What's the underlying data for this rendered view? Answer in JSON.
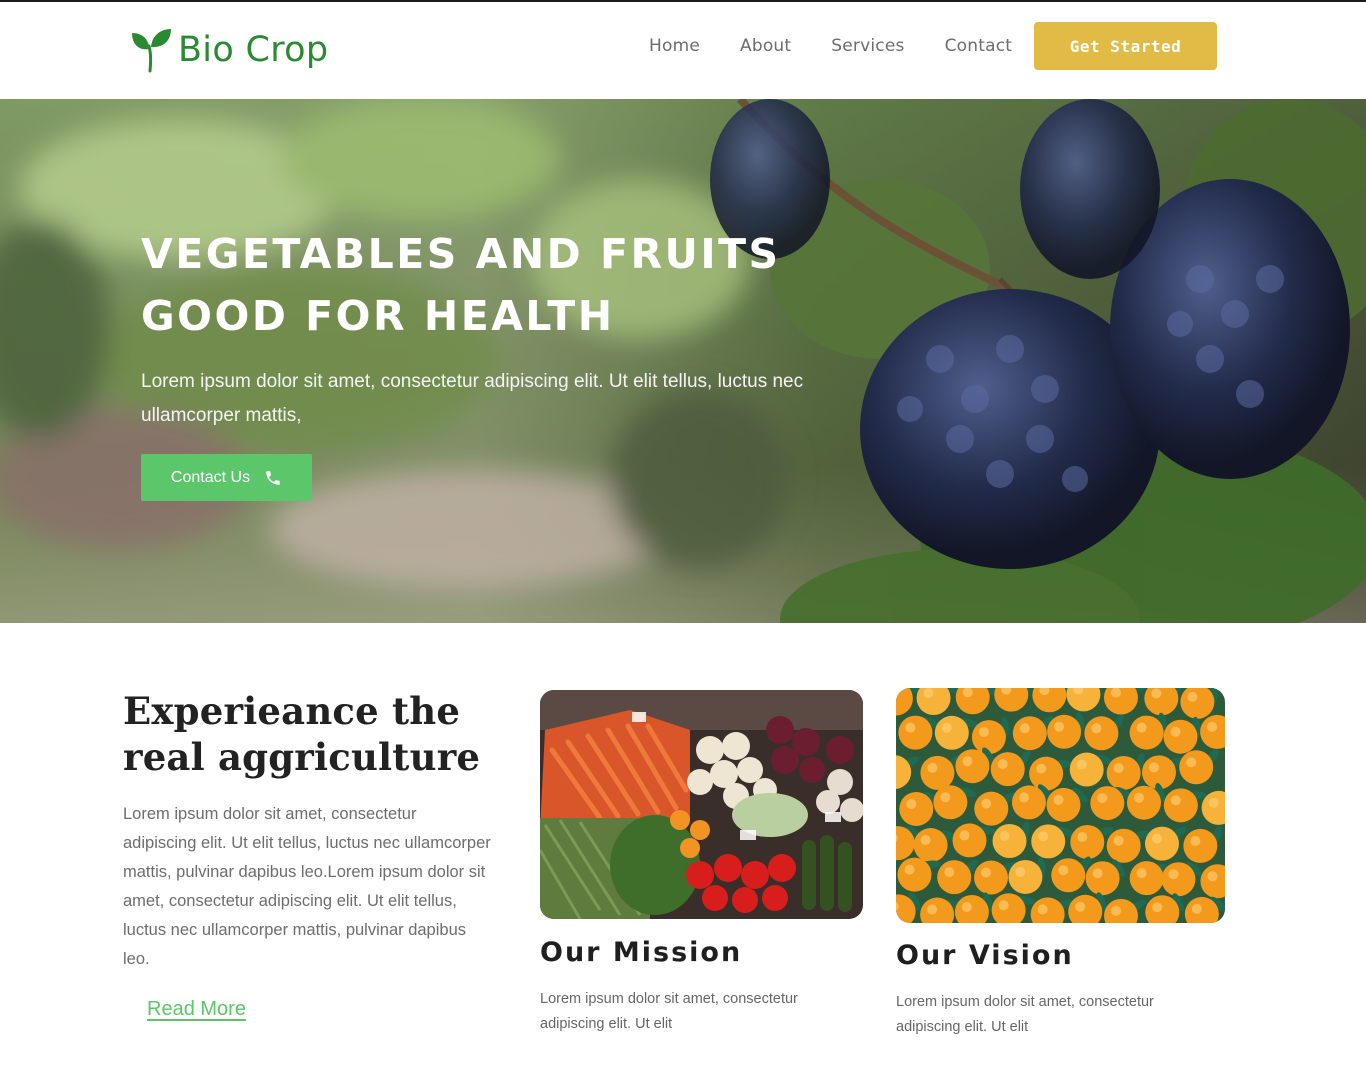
{
  "brand": {
    "name": "Bio Crop",
    "icon": "leaf-icon",
    "color": "#2a8a32"
  },
  "nav": {
    "items": [
      "Home",
      "About",
      "Services",
      "Contact"
    ],
    "cta": "Get Started",
    "cta_color": "#e2bb46"
  },
  "hero": {
    "title_line1": "VEGETABLES AND FRUITS",
    "title_line2": "GOOD FOR HEALTH",
    "text": "Lorem ipsum dolor sit amet, consectetur adipiscing elit. Ut elit tellus, luctus nec ullamcorper mattis,",
    "button": "Contact Us",
    "button_icon": "phone-icon",
    "button_color": "#5cc66a",
    "background": "grapes-vineyard-photo"
  },
  "intro": {
    "title_line1": "Experieance the",
    "title_line2": "real aggriculture",
    "text": "Lorem ipsum dolor sit amet, consectetur adipiscing elit. Ut elit tellus, luctus nec ullamcorper mattis, pulvinar dapibus leo.Lorem ipsum dolor sit amet, consectetur adipiscing elit. Ut elit tellus, luctus nec ullamcorper mattis, pulvinar dapibus leo.",
    "link": "Read More"
  },
  "cards": [
    {
      "image": "vegetable-market-photo",
      "title": "Our Mission",
      "text": "Lorem ipsum dolor sit amet, consectetur adipiscing elit. Ut elit"
    },
    {
      "image": "oranges-photo",
      "title": "Our Vision",
      "text": "Lorem ipsum dolor sit amet, consectetur adipiscing elit. Ut elit"
    }
  ]
}
